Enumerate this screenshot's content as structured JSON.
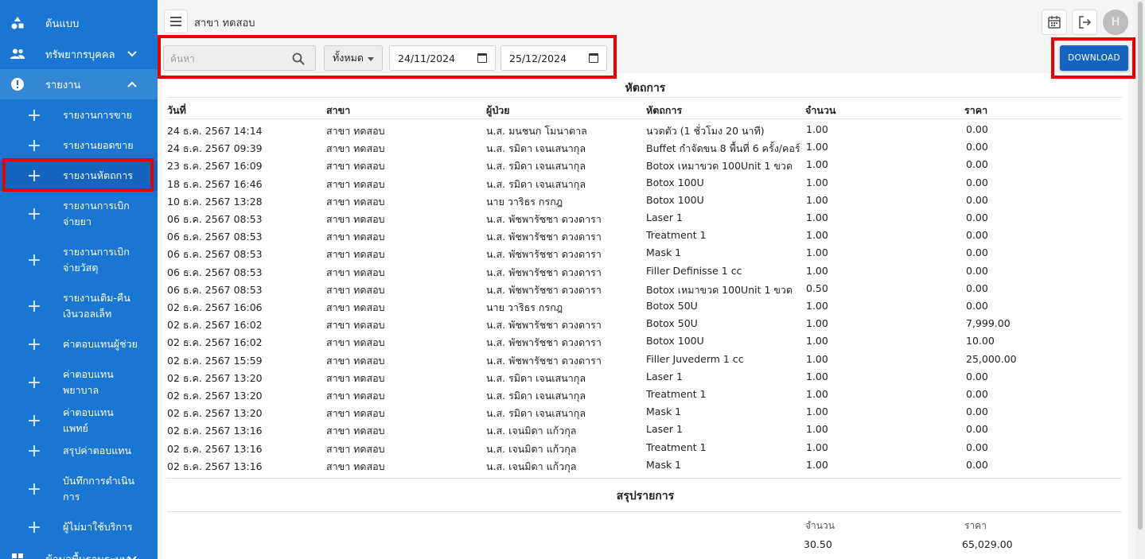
{
  "sidebar": {
    "top_items": [
      {
        "label": "ต้นแบบ",
        "icon": "shapes-icon",
        "has_chevron": false
      },
      {
        "label": "ทรัพยากรบุคคล",
        "icon": "people-icon",
        "chevron": "∨"
      },
      {
        "label": "รายงาน",
        "icon": "report-icon",
        "chevron": "∧"
      }
    ],
    "sub_items": [
      {
        "label": "รายงานการขาย"
      },
      {
        "label": "รายงานยอดขาย"
      },
      {
        "label": "รายงานหัตถการ"
      },
      {
        "label": "รายงานการเบิกจ่ายยา"
      },
      {
        "label": "รายงานการเบิกจ่ายวัสดุ"
      },
      {
        "label": "รายงานเติม-คืนเงินวอลเล็ท"
      },
      {
        "label": "ค่าตอบแทนผู้ช่วย"
      },
      {
        "label": "ค่าตอบแทนพยาบาล"
      },
      {
        "label": "ค่าตอบแทนแพทย์"
      },
      {
        "label": "สรุปค่าตอบแทน"
      },
      {
        "label": "บันทึกการดำเนินการ"
      },
      {
        "label": "ผู้ไม่มาใช้บริการ"
      }
    ],
    "bottom_item": {
      "label": "ข้อมูลพื้นฐานระบบ",
      "icon": "grid-icon",
      "chevron": "∨"
    }
  },
  "header": {
    "branch": "สาขา ทดสอบ",
    "avatar_letter": "H"
  },
  "filters": {
    "search_placeholder": "ค้นหา",
    "select_value": "ทั้งหมด",
    "date_from": "24/11/2024",
    "date_to": "25/12/2024",
    "download_label": "DOWNLOAD"
  },
  "report": {
    "title": "หัตถการ",
    "columns": [
      "วันที่",
      "สาขา",
      "ผู้ป่วย",
      "หัตถการ",
      "จำนวน",
      "ราคา"
    ],
    "rows": [
      [
        "24 ธ.ค. 2567 14:14",
        "สาขา ทดสอบ",
        "น.ส. มนชนก โมนาตาล",
        "นวดตัว (1 ชั่วโมง 20 นาที)",
        "1.00",
        "0.00"
      ],
      [
        "24 ธ.ค. 2567 09:39",
        "สาขา ทดสอบ",
        "น.ส. รมิดา เจนเสนากุล",
        "Buffet กำจัดขน 8 พื้นที่ 6 ครั้ง/คอร์ส",
        "1.00",
        "0.00"
      ],
      [
        "23 ธ.ค. 2567 16:09",
        "สาขา ทดสอบ",
        "น.ส. รมิดา เจนเสนากุล",
        "Botox เหมาขวด 100Unit 1 ขวด",
        "1.00",
        "0.00"
      ],
      [
        "18 ธ.ค. 2567 16:46",
        "สาขา ทดสอบ",
        "น.ส. รมิดา เจนเสนากุล",
        "Botox 100U",
        "1.00",
        "0.00"
      ],
      [
        "10 ธ.ค. 2567 13:28",
        "สาขา ทดสอบ",
        "นาย วาริธร กรกฎ",
        "Botox 100U",
        "1.00",
        "0.00"
      ],
      [
        "06 ธ.ค. 2567 08:53",
        "สาขา ทดสอบ",
        "น.ส. พัชพารัชชา ดวงดารา",
        "Laser 1",
        "1.00",
        "0.00"
      ],
      [
        "06 ธ.ค. 2567 08:53",
        "สาขา ทดสอบ",
        "น.ส. พัชพารัชชา ดวงดารา",
        "Treatment 1",
        "1.00",
        "0.00"
      ],
      [
        "06 ธ.ค. 2567 08:53",
        "สาขา ทดสอบ",
        "น.ส. พัชพารัชชา ดวงดารา",
        "Mask 1",
        "1.00",
        "0.00"
      ],
      [
        "06 ธ.ค. 2567 08:53",
        "สาขา ทดสอบ",
        "น.ส. พัชพารัชชา ดวงดารา",
        "Filler Definisse 1 cc",
        "1.00",
        "0.00"
      ],
      [
        "06 ธ.ค. 2567 08:53",
        "สาขา ทดสอบ",
        "น.ส. พัชพารัชชา ดวงดารา",
        "Botox เหมาขวด 100Unit 1 ขวด",
        "0.50",
        "0.00"
      ],
      [
        "02 ธ.ค. 2567 16:06",
        "สาขา ทดสอบ",
        "นาย วาริธร กรกฎ",
        "Botox 50U",
        "1.00",
        "0.00"
      ],
      [
        "02 ธ.ค. 2567 16:02",
        "สาขา ทดสอบ",
        "น.ส. พัชพารัชชา ดวงดารา",
        "Botox 50U",
        "1.00",
        "7,999.00"
      ],
      [
        "02 ธ.ค. 2567 16:02",
        "สาขา ทดสอบ",
        "น.ส. พัชพารัชชา ดวงดารา",
        "Botox 100U",
        "1.00",
        "10.00"
      ],
      [
        "02 ธ.ค. 2567 15:59",
        "สาขา ทดสอบ",
        "น.ส. พัชพารัชชา ดวงดารา",
        "Filler Juvederm 1 cc",
        "1.00",
        "25,000.00"
      ],
      [
        "02 ธ.ค. 2567 13:20",
        "สาขา ทดสอบ",
        "น.ส. รมิดา เจนเสนากุล",
        "Laser 1",
        "1.00",
        "0.00"
      ],
      [
        "02 ธ.ค. 2567 13:20",
        "สาขา ทดสอบ",
        "น.ส. รมิดา เจนเสนากุล",
        "Treatment 1",
        "1.00",
        "0.00"
      ],
      [
        "02 ธ.ค. 2567 13:20",
        "สาขา ทดสอบ",
        "น.ส. รมิดา เจนเสนากุล",
        "Mask 1",
        "1.00",
        "0.00"
      ],
      [
        "02 ธ.ค. 2567 13:16",
        "สาขา ทดสอบ",
        "น.ส. เจนมิดา แก้วกุล",
        "Laser 1",
        "1.00",
        "0.00"
      ],
      [
        "02 ธ.ค. 2567 13:16",
        "สาขา ทดสอบ",
        "น.ส. เจนมิดา แก้วกุล",
        "Treatment 1",
        "1.00",
        "0.00"
      ],
      [
        "02 ธ.ค. 2567 13:16",
        "สาขา ทดสอบ",
        "น.ส. เจนมิดา แก้วกุล",
        "Mask 1",
        "1.00",
        "0.00"
      ]
    ]
  },
  "summary": {
    "title": "สรุปรายการ",
    "qty_label": "จำนวน",
    "price_label": "ราคา",
    "qty_total": "30.50",
    "price_total": "65,029.00"
  },
  "colors": {
    "sidebar": "#1976d2",
    "sidebar_active": "#1565c0",
    "highlight": "#e60000",
    "download_button": "#1565c0"
  }
}
